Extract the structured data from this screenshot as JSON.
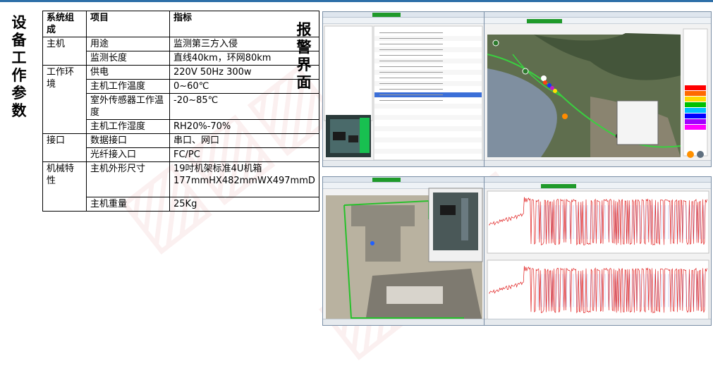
{
  "left_title": "设备工作参数",
  "right_title": "报警界面",
  "table": {
    "headers": [
      "系统组成",
      "项目",
      "指标"
    ],
    "rows": [
      [
        "主机",
        "用途",
        "监测第三方入侵"
      ],
      [
        "",
        "监测长度",
        "直线40km，环网80km"
      ],
      [
        "工作环境",
        "供电",
        "220V 50Hz 300w"
      ],
      [
        "",
        "主机工作温度",
        "0~60℃"
      ],
      [
        "",
        "室外传感器工作温度",
        "-20~85℃"
      ],
      [
        "",
        "主机工作湿度",
        "RH20%-70%"
      ],
      [
        "接口",
        "数据接口",
        "串口、网口"
      ],
      [
        "",
        "光纤接入口",
        "FC/PC"
      ],
      [
        "机械特性",
        "主机外形尺寸",
        "19吋机架标准4U机箱177mmHX482mmWX497mmD"
      ],
      [
        "",
        "主机重量",
        "25Kg"
      ]
    ]
  },
  "colors": {
    "accent_line": "#2d6fa8",
    "app_green": "#1f9a2a",
    "waveform_red": "#e02020",
    "waveform_blue": "#3a4fd0",
    "alarm_legend": [
      "#ff0000",
      "#ff6a00",
      "#ffd800",
      "#00c000",
      "#00c0ff",
      "#0000ff",
      "#a000ff",
      "#ff00ff"
    ]
  }
}
